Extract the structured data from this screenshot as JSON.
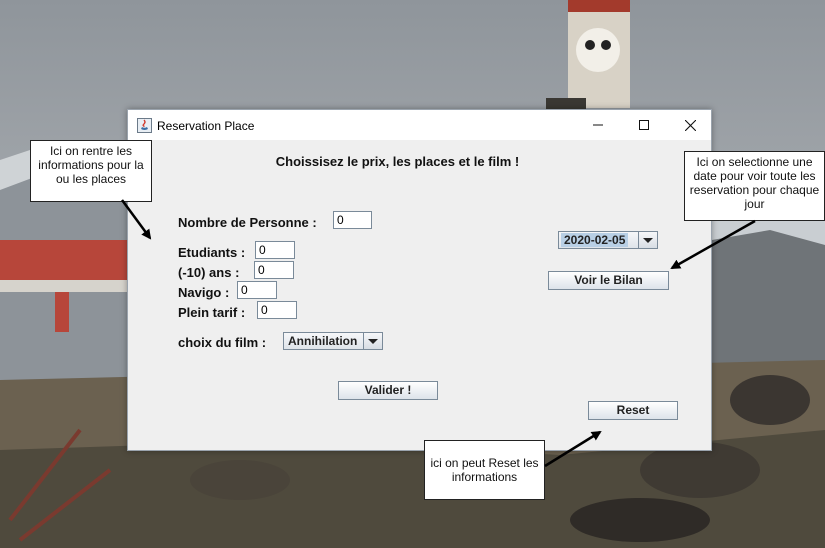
{
  "window": {
    "title": "Reservation Place",
    "controls": {
      "minimize": "minimize-icon",
      "maximize": "maximize-icon",
      "close": "close-icon"
    }
  },
  "form": {
    "heading": "Choissisez le prix, les places et le film !",
    "nombre_personne": {
      "label": "Nombre de Personne :",
      "value": "0"
    },
    "etudiants": {
      "label": "Etudiants :",
      "value": "0"
    },
    "moins_10": {
      "label": "(-10) ans :",
      "value": "0"
    },
    "navigo": {
      "label": "Navigo :",
      "value": "0"
    },
    "plein_tarif": {
      "label": "Plein tarif :",
      "value": "0"
    },
    "film": {
      "label": "choix du film :",
      "selected": "Annihilation"
    },
    "date_selected": "2020-02-05",
    "voir_bilan": "Voir le Bilan",
    "valider": "Valider !",
    "reset": "Reset"
  },
  "callouts": {
    "infos": "Ici on rentre les informations pour la ou les places",
    "date": "Ici on selectionne une date pour voir toute les reservation pour chaque jour",
    "reset": "ici on peut Reset les informations"
  },
  "colors": {
    "selection": "#b8cfe5",
    "window_bg": "#efefef",
    "border": "#7a8a99"
  }
}
